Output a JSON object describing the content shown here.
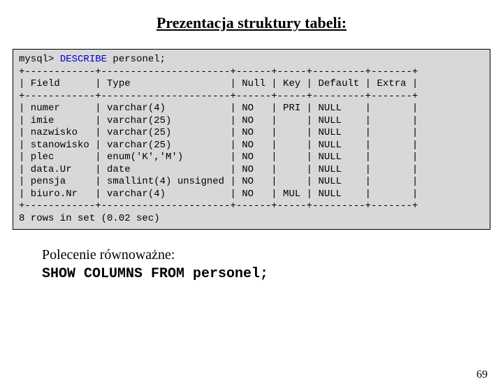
{
  "title": "Prezentacja struktury tabeli:",
  "prompt": "mysql> ",
  "keyword": "DESCRIBE",
  "cmd_tail": " personel;",
  "hr": "+------------+----------------------+------+-----+---------+-------+",
  "hdr": "| Field      | Type                 | Null | Key | Default | Extra |",
  "rows": [
    "| numer      | varchar(4)           | NO   | PRI | NULL    |       |",
    "| imie       | varchar(25)          | NO   |     | NULL    |       |",
    "| nazwisko   | varchar(25)          | NO   |     | NULL    |       |",
    "| stanowisko | varchar(25)          | NO   |     | NULL    |       |",
    "| plec       | enum('K','M')        | NO   |     | NULL    |       |",
    "| data.Ur    | date                 | NO   |     | NULL    |       |",
    "| pensja     | smallint(4) unsigned | NO   |     | NULL    |       |",
    "| biuro.Nr   | varchar(4)           | NO   | MUL | NULL    |       |"
  ],
  "footer": "8 rows in set (0.02 sec)",
  "equiv_label": "Polecenie równoważne:",
  "equiv_cmd": "SHOW COLUMNS FROM personel;",
  "page": "69",
  "chart_data": {
    "type": "table",
    "columns": [
      "Field",
      "Type",
      "Null",
      "Key",
      "Default",
      "Extra"
    ],
    "data": [
      [
        "numer",
        "varchar(4)",
        "NO",
        "PRI",
        "NULL",
        ""
      ],
      [
        "imie",
        "varchar(25)",
        "NO",
        "",
        "NULL",
        ""
      ],
      [
        "nazwisko",
        "varchar(25)",
        "NO",
        "",
        "NULL",
        ""
      ],
      [
        "stanowisko",
        "varchar(25)",
        "NO",
        "",
        "NULL",
        ""
      ],
      [
        "plec",
        "enum('K','M')",
        "NO",
        "",
        "NULL",
        ""
      ],
      [
        "data.Ur",
        "date",
        "NO",
        "",
        "NULL",
        ""
      ],
      [
        "pensja",
        "smallint(4) unsigned",
        "NO",
        "",
        "NULL",
        ""
      ],
      [
        "biuro.Nr",
        "varchar(4)",
        "NO",
        "MUL",
        "NULL",
        ""
      ]
    ]
  }
}
